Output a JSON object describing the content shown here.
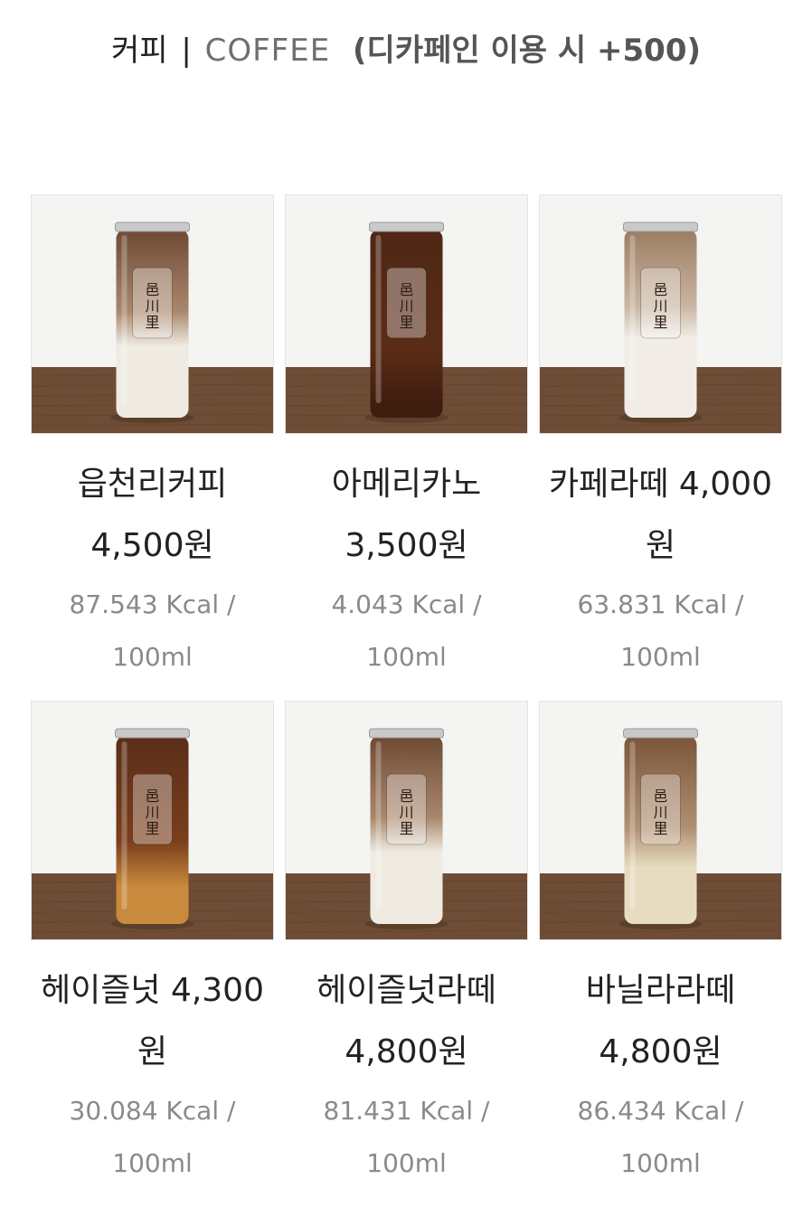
{
  "header": {
    "ko": "커피",
    "sep": "|",
    "en": "COFFEE",
    "note": "(디카페인 이용 시 +500)"
  },
  "menu": [
    {
      "line1": "읍천리커피",
      "line2": "4,500원",
      "kcal": "87.543 Kcal /",
      "volume": "100ml",
      "drink": "latte-dark-top",
      "label": "邑川里"
    },
    {
      "line1": "아메리카노",
      "line2": "3,500원",
      "kcal": "4.043 Kcal /",
      "volume": "100ml",
      "drink": "americano",
      "label": "邑川里"
    },
    {
      "line1": "카페라떼 4,000",
      "line2": "원",
      "kcal": "63.831 Kcal /",
      "volume": "100ml",
      "drink": "latte-light",
      "label": "邑川里"
    },
    {
      "line1": "헤이즐넛 4,300",
      "line2": "원",
      "kcal": "30.084 Kcal /",
      "volume": "100ml",
      "drink": "hazelnut",
      "label": "邑川里"
    },
    {
      "line1": "헤이즐넛라떼",
      "line2": "4,800원",
      "kcal": "81.431 Kcal /",
      "volume": "100ml",
      "drink": "latte-dark-top",
      "label": "邑川里"
    },
    {
      "line1": "바닐라라떼",
      "line2": "4,800원",
      "kcal": "86.434 Kcal /",
      "volume": "100ml",
      "drink": "vanilla-latte",
      "label": "邑川里"
    }
  ],
  "colors": {
    "wood": "#6b4a33",
    "coffee": "#5a3522",
    "milk": "#f0ece4",
    "americano": "#4a2414"
  }
}
